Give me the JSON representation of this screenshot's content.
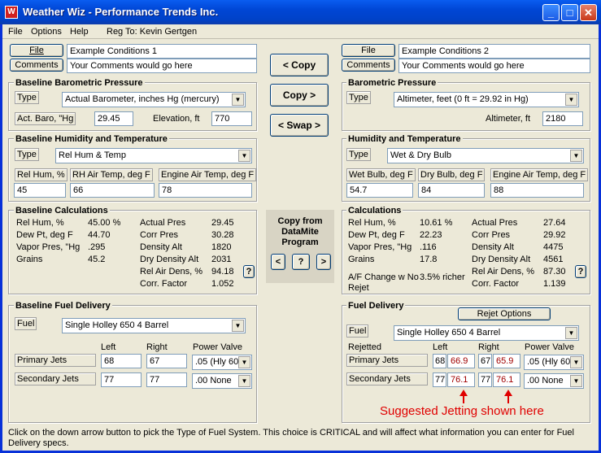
{
  "window": {
    "title": "Weather Wiz - Performance Trends Inc.",
    "min": "_",
    "max": "□",
    "close": "✕"
  },
  "menu": {
    "file": "File",
    "options": "Options",
    "help": "Help",
    "reg": "Reg To: Kevin Gertgen"
  },
  "left": {
    "file_btn": "File",
    "comments_btn": "Comments",
    "file_value": "Example Conditions 1",
    "comments_value": "Your Comments would go here",
    "baro": {
      "title": "Baseline Barometric Pressure",
      "type_label": "Type",
      "type_value": "Actual Barometer, inches Hg (mercury)",
      "act_label": "Act. Baro, \"Hg",
      "act_value": "29.45",
      "elev_label": "Elevation, ft",
      "elev_value": "770"
    },
    "humid": {
      "title": "Baseline Humidity and Temperature",
      "type_label": "Type",
      "type_value": "Rel Hum & Temp",
      "c1_label": "Rel Hum, %",
      "c1_value": "45",
      "c2_label": "RH Air Temp, deg F",
      "c2_value": "66",
      "c3_label": "Engine Air Temp, deg F",
      "c3_value": "78"
    },
    "calc": {
      "title": "Baseline Calculations",
      "rows": [
        [
          "Rel Hum, %",
          "45.00 %"
        ],
        [
          "Dew Pt, deg F",
          "44.70"
        ],
        [
          "Vapor Pres, \"Hg",
          ".295"
        ],
        [
          "Grains",
          "45.2"
        ]
      ],
      "rows2": [
        [
          "Actual Pres",
          "29.45"
        ],
        [
          "Corr Pres",
          "30.28"
        ],
        [
          "Density Alt",
          "1820"
        ],
        [
          "Dry Density Alt",
          "2031"
        ],
        [
          "Rel Air Dens, %",
          "94.18"
        ],
        [
          "Corr. Factor",
          "1.052"
        ]
      ],
      "help": "?"
    },
    "fuel": {
      "title": "Baseline Fuel Delivery",
      "fuel_label": "Fuel",
      "fuel_value": "Single Holley 650 4 Barrel",
      "left": "Left",
      "right": "Right",
      "pv": "Power Valve",
      "primary": "Primary Jets",
      "secondary": "Secondary Jets",
      "p_left": "68",
      "p_right": "67",
      "p_pv": ".05 (Hly 60(",
      "s_left": "77",
      "s_right": "77",
      "s_pv": ".00 None"
    }
  },
  "center": {
    "copy_left": "< Copy",
    "copy_right": "Copy >",
    "swap": "< Swap >",
    "datamite": "Copy from DataMite Program",
    "b1": "<",
    "b2": "?",
    "b3": ">"
  },
  "right": {
    "file_btn": "File",
    "comments_btn": "Comments",
    "file_value": "Example Conditions 2",
    "comments_value": "Your Comments would go here",
    "baro": {
      "title": "Barometric Pressure",
      "type_label": "Type",
      "type_value": "Altimeter, feet (0 ft = 29.92 in Hg)",
      "alt_label": "Altimeter, ft",
      "alt_value": "2180"
    },
    "humid": {
      "title": "Humidity and Temperature",
      "type_label": "Type",
      "type_value": "Wet & Dry Bulb",
      "c1_label": "Wet Bulb, deg F",
      "c1_value": "54.7",
      "c2_label": "Dry Bulb, deg F",
      "c2_value": "84",
      "c3_label": "Engine Air Temp, deg F",
      "c3_value": "88"
    },
    "calc": {
      "title": "Calculations",
      "rows": [
        [
          "Rel Hum, %",
          "10.61 %"
        ],
        [
          "Dew Pt, deg F",
          "22.23"
        ],
        [
          "Vapor Pres, \"Hg",
          ".116"
        ],
        [
          "Grains",
          "17.8"
        ]
      ],
      "rows2": [
        [
          "Actual Pres",
          "27.64"
        ],
        [
          "Corr Pres",
          "29.92"
        ],
        [
          "Density Alt",
          "4475"
        ],
        [
          "Dry Density Alt",
          "4561"
        ],
        [
          "Rel Air Dens, %",
          "87.30"
        ],
        [
          "Corr. Factor",
          "1.139"
        ]
      ],
      "af_label": "A/F Change w No Rejet",
      "af_value": "3.5% richer",
      "help": "?"
    },
    "fuel": {
      "title": "Fuel Delivery",
      "rejet": "Rejet Options",
      "fuel_label": "Fuel",
      "fuel_value": "Single Holley 650 4 Barrel",
      "rejetted": "Rejetted",
      "left": "Left",
      "right": "Right",
      "pv": "Power Valve",
      "primary": "Primary Jets",
      "secondary": "Secondary Jets",
      "p_left": "68",
      "p_left_s": "66.9",
      "p_right": "67",
      "p_right_s": "65.9",
      "p_pv": ".05 (Hly 60(",
      "s_left": "77",
      "s_left_s": "76.1",
      "s_right": "77",
      "s_right_s": "76.1",
      "s_pv": ".00 None"
    },
    "annotation": "Suggested Jetting shown here"
  },
  "status": "Click on the down arrow button to pick the Type of Fuel System.  This choice is CRITICAL and will affect what information you can enter for Fuel Delivery specs."
}
